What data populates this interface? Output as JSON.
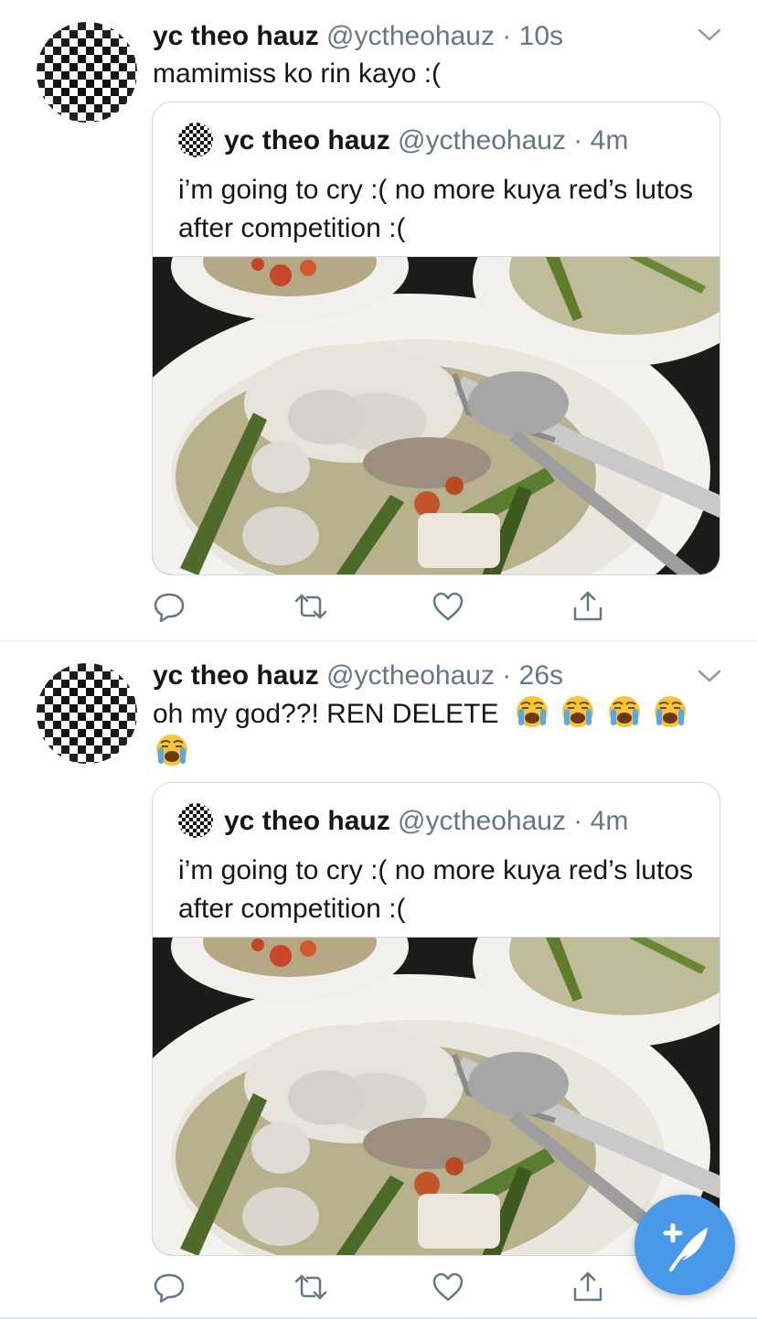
{
  "tweets": [
    {
      "name": "yc theo hauz",
      "handle": "@yctheohauz",
      "time": "10s",
      "text": "mamimiss ko rin kayo :(",
      "quoted": {
        "name": "yc theo hauz",
        "handle": "@yctheohauz",
        "time": "4m",
        "text": "i’m going to cry :( no more kuya red’s lutos after competition :("
      }
    },
    {
      "name": "yc theo hauz",
      "handle": "@yctheohauz",
      "time": "26s",
      "text": "oh my god??! REN DELETE",
      "emoji_count": 5,
      "quoted": {
        "name": "yc theo hauz",
        "handle": "@yctheohauz",
        "time": "4m",
        "text": "i’m going to cry :( no more kuya red’s lutos after competition :("
      }
    }
  ],
  "separator": "·",
  "icons": [
    "chevron-down-icon",
    "reply-icon",
    "retweet-icon",
    "like-icon",
    "share-icon",
    "compose-icon",
    "loudly-crying-face-emoji"
  ],
  "colors": {
    "accent": "#4a99e9",
    "secondary_text": "#657786",
    "border": "#ccd6dd",
    "icon": "#657786"
  }
}
